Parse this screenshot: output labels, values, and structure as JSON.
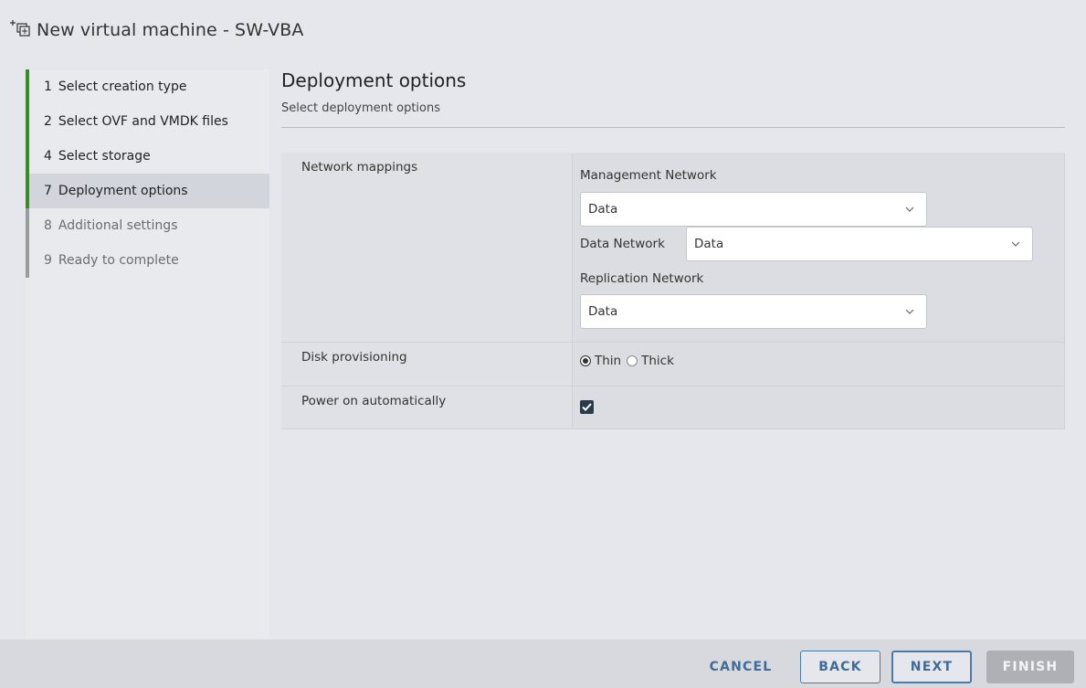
{
  "window": {
    "title": "New virtual machine - SW-VBA",
    "icon": "new-vm-icon"
  },
  "sidebar": {
    "steps": [
      {
        "num": "1",
        "label": "Select creation type",
        "state": "done"
      },
      {
        "num": "2",
        "label": "Select OVF and VMDK files",
        "state": "done"
      },
      {
        "num": "4",
        "label": "Select storage",
        "state": "done"
      },
      {
        "num": "7",
        "label": "Deployment options",
        "state": "current"
      },
      {
        "num": "8",
        "label": "Additional settings",
        "state": "todo"
      },
      {
        "num": "9",
        "label": "Ready to complete",
        "state": "todo"
      }
    ]
  },
  "main": {
    "title": "Deployment options",
    "subtitle": "Select deployment options",
    "network": {
      "label": "Network mappings",
      "management_label": "Management Network",
      "management_value": "Data",
      "data_label": "Data Network",
      "data_value": "Data",
      "replication_label": "Replication Network",
      "replication_value": "Data"
    },
    "disk": {
      "label": "Disk provisioning",
      "thin_label": "Thin",
      "thick_label": "Thick",
      "selected": "Thin"
    },
    "power": {
      "label": "Power on automatically",
      "checked": true
    }
  },
  "footer": {
    "cancel": "CANCEL",
    "back": "BACK",
    "next": "NEXT",
    "finish": "FINISH"
  },
  "colors": {
    "accent_blue": "#3d6c99",
    "step_done_bar": "#3a8a2a",
    "step_todo_bar": "#9a9ca3"
  }
}
